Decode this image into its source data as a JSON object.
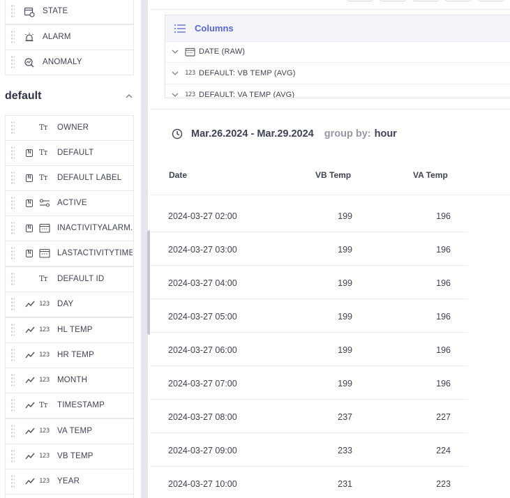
{
  "sidebar": {
    "top_items": [
      {
        "label": "STATE",
        "icon": "calendar-gear-icon"
      },
      {
        "label": "ALARM",
        "icon": "alarm-icon"
      },
      {
        "label": "ANOMALY",
        "icon": "anomaly-search-icon"
      }
    ],
    "section_title": "default",
    "items": [
      {
        "label": "OWNER",
        "key": false,
        "trend": false,
        "type": "Tт"
      },
      {
        "label": "DEFAULT",
        "key": true,
        "trend": false,
        "type": "Tт"
      },
      {
        "label": "DEFAULT LABEL",
        "key": true,
        "trend": false,
        "type": "Tт"
      },
      {
        "label": "ACTIVE",
        "key": true,
        "trend": false,
        "type": "toggle"
      },
      {
        "label": "INACTIVITYALARM...",
        "key": true,
        "trend": false,
        "type": "date"
      },
      {
        "label": "LASTACTIVITYTIME",
        "key": true,
        "trend": false,
        "type": "date"
      },
      {
        "label": "DEFAULT ID",
        "key": false,
        "trend": false,
        "type": "Tт"
      },
      {
        "label": "DAY",
        "key": false,
        "trend": true,
        "type": "123"
      },
      {
        "label": "HL TEMP",
        "key": false,
        "trend": true,
        "type": "123"
      },
      {
        "label": "HR TEMP",
        "key": false,
        "trend": true,
        "type": "123"
      },
      {
        "label": "MONTH",
        "key": false,
        "trend": true,
        "type": "123"
      },
      {
        "label": "TIMESTAMP",
        "key": false,
        "trend": true,
        "type": "Tт"
      },
      {
        "label": "VA TEMP",
        "key": false,
        "trend": true,
        "type": "123"
      },
      {
        "label": "VB TEMP",
        "key": false,
        "trend": true,
        "type": "123"
      },
      {
        "label": "YEAR",
        "key": false,
        "trend": true,
        "type": "123"
      }
    ]
  },
  "columns_panel": {
    "title": "Columns",
    "rows": [
      {
        "type": "date",
        "label": "DATE (RAW)"
      },
      {
        "type": "123",
        "label": "DEFAULT: VB TEMP (AVG)"
      },
      {
        "type": "123",
        "label": "DEFAULT: VA TEMP (AVG)"
      }
    ]
  },
  "range": {
    "dates": "Mar.26.2024 - Mar.29.2024",
    "group_by_label": "group by:",
    "group_by_value": "hour"
  },
  "table": {
    "headers": {
      "date": "Date",
      "vb": "VB Temp",
      "va": "VA Temp"
    },
    "rows": [
      {
        "date": "2024-03-27 02:00",
        "vb": "199",
        "va": "196"
      },
      {
        "date": "2024-03-27 03:00",
        "vb": "199",
        "va": "196"
      },
      {
        "date": "2024-03-27 04:00",
        "vb": "199",
        "va": "196"
      },
      {
        "date": "2024-03-27 05:00",
        "vb": "199",
        "va": "196"
      },
      {
        "date": "2024-03-27 06:00",
        "vb": "199",
        "va": "196"
      },
      {
        "date": "2024-03-27 07:00",
        "vb": "199",
        "va": "196"
      },
      {
        "date": "2024-03-27 08:00",
        "vb": "237",
        "va": "227"
      },
      {
        "date": "2024-03-27 09:00",
        "vb": "233",
        "va": "224"
      },
      {
        "date": "2024-03-27 10:00",
        "vb": "231",
        "va": "223"
      }
    ]
  },
  "colors": {
    "accent": "#5a63d8",
    "text": "#3d4354",
    "muted": "#9599a6",
    "border": "#e6e8ee"
  }
}
